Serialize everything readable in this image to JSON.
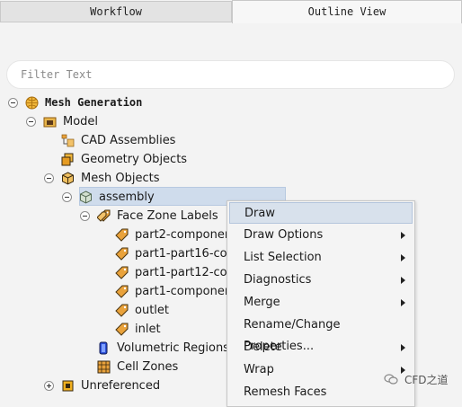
{
  "tabs": {
    "workflow": "Workflow",
    "outline": "Outline View"
  },
  "filter": {
    "placeholder": "Filter Text"
  },
  "tree": {
    "mesh_generation": "Mesh Generation",
    "model": "Model",
    "cad_assemblies": "CAD Assemblies",
    "geometry_objects": "Geometry Objects",
    "mesh_objects": "Mesh Objects",
    "assembly": "assembly",
    "face_zone_labels": "Face Zone Labels",
    "zones": [
      "part2-componer",
      "part1-part16-co",
      "part1-part12-co",
      "part1-componer",
      "outlet",
      "inlet"
    ],
    "volumetric_regions": "Volumetric Regions",
    "cell_zones": "Cell Zones",
    "unreferenced": "Unreferenced"
  },
  "context_menu": {
    "items": [
      "Draw",
      "Draw Options",
      "List Selection",
      "Diagnostics",
      "Merge",
      "Rename/Change Properties...",
      "Delete",
      "Wrap",
      "Remesh Faces"
    ]
  },
  "watermark": "CFD之道"
}
